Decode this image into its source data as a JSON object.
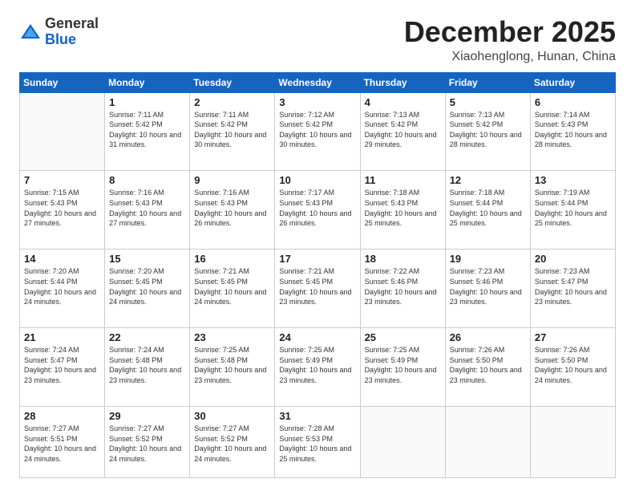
{
  "logo": {
    "general": "General",
    "blue": "Blue"
  },
  "header": {
    "month": "December 2025",
    "location": "Xiaohenglong, Hunan, China"
  },
  "weekdays": [
    "Sunday",
    "Monday",
    "Tuesday",
    "Wednesday",
    "Thursday",
    "Friday",
    "Saturday"
  ],
  "weeks": [
    [
      {
        "day": "",
        "sunrise": "",
        "sunset": "",
        "daylight": ""
      },
      {
        "day": "1",
        "sunrise": "Sunrise: 7:11 AM",
        "sunset": "Sunset: 5:42 PM",
        "daylight": "Daylight: 10 hours and 31 minutes."
      },
      {
        "day": "2",
        "sunrise": "Sunrise: 7:11 AM",
        "sunset": "Sunset: 5:42 PM",
        "daylight": "Daylight: 10 hours and 30 minutes."
      },
      {
        "day": "3",
        "sunrise": "Sunrise: 7:12 AM",
        "sunset": "Sunset: 5:42 PM",
        "daylight": "Daylight: 10 hours and 30 minutes."
      },
      {
        "day": "4",
        "sunrise": "Sunrise: 7:13 AM",
        "sunset": "Sunset: 5:42 PM",
        "daylight": "Daylight: 10 hours and 29 minutes."
      },
      {
        "day": "5",
        "sunrise": "Sunrise: 7:13 AM",
        "sunset": "Sunset: 5:42 PM",
        "daylight": "Daylight: 10 hours and 28 minutes."
      },
      {
        "day": "6",
        "sunrise": "Sunrise: 7:14 AM",
        "sunset": "Sunset: 5:43 PM",
        "daylight": "Daylight: 10 hours and 28 minutes."
      }
    ],
    [
      {
        "day": "7",
        "sunrise": "Sunrise: 7:15 AM",
        "sunset": "Sunset: 5:43 PM",
        "daylight": "Daylight: 10 hours and 27 minutes."
      },
      {
        "day": "8",
        "sunrise": "Sunrise: 7:16 AM",
        "sunset": "Sunset: 5:43 PM",
        "daylight": "Daylight: 10 hours and 27 minutes."
      },
      {
        "day": "9",
        "sunrise": "Sunrise: 7:16 AM",
        "sunset": "Sunset: 5:43 PM",
        "daylight": "Daylight: 10 hours and 26 minutes."
      },
      {
        "day": "10",
        "sunrise": "Sunrise: 7:17 AM",
        "sunset": "Sunset: 5:43 PM",
        "daylight": "Daylight: 10 hours and 26 minutes."
      },
      {
        "day": "11",
        "sunrise": "Sunrise: 7:18 AM",
        "sunset": "Sunset: 5:43 PM",
        "daylight": "Daylight: 10 hours and 25 minutes."
      },
      {
        "day": "12",
        "sunrise": "Sunrise: 7:18 AM",
        "sunset": "Sunset: 5:44 PM",
        "daylight": "Daylight: 10 hours and 25 minutes."
      },
      {
        "day": "13",
        "sunrise": "Sunrise: 7:19 AM",
        "sunset": "Sunset: 5:44 PM",
        "daylight": "Daylight: 10 hours and 25 minutes."
      }
    ],
    [
      {
        "day": "14",
        "sunrise": "Sunrise: 7:20 AM",
        "sunset": "Sunset: 5:44 PM",
        "daylight": "Daylight: 10 hours and 24 minutes."
      },
      {
        "day": "15",
        "sunrise": "Sunrise: 7:20 AM",
        "sunset": "Sunset: 5:45 PM",
        "daylight": "Daylight: 10 hours and 24 minutes."
      },
      {
        "day": "16",
        "sunrise": "Sunrise: 7:21 AM",
        "sunset": "Sunset: 5:45 PM",
        "daylight": "Daylight: 10 hours and 24 minutes."
      },
      {
        "day": "17",
        "sunrise": "Sunrise: 7:21 AM",
        "sunset": "Sunset: 5:45 PM",
        "daylight": "Daylight: 10 hours and 23 minutes."
      },
      {
        "day": "18",
        "sunrise": "Sunrise: 7:22 AM",
        "sunset": "Sunset: 5:46 PM",
        "daylight": "Daylight: 10 hours and 23 minutes."
      },
      {
        "day": "19",
        "sunrise": "Sunrise: 7:23 AM",
        "sunset": "Sunset: 5:46 PM",
        "daylight": "Daylight: 10 hours and 23 minutes."
      },
      {
        "day": "20",
        "sunrise": "Sunrise: 7:23 AM",
        "sunset": "Sunset: 5:47 PM",
        "daylight": "Daylight: 10 hours and 23 minutes."
      }
    ],
    [
      {
        "day": "21",
        "sunrise": "Sunrise: 7:24 AM",
        "sunset": "Sunset: 5:47 PM",
        "daylight": "Daylight: 10 hours and 23 minutes."
      },
      {
        "day": "22",
        "sunrise": "Sunrise: 7:24 AM",
        "sunset": "Sunset: 5:48 PM",
        "daylight": "Daylight: 10 hours and 23 minutes."
      },
      {
        "day": "23",
        "sunrise": "Sunrise: 7:25 AM",
        "sunset": "Sunset: 5:48 PM",
        "daylight": "Daylight: 10 hours and 23 minutes."
      },
      {
        "day": "24",
        "sunrise": "Sunrise: 7:25 AM",
        "sunset": "Sunset: 5:49 PM",
        "daylight": "Daylight: 10 hours and 23 minutes."
      },
      {
        "day": "25",
        "sunrise": "Sunrise: 7:25 AM",
        "sunset": "Sunset: 5:49 PM",
        "daylight": "Daylight: 10 hours and 23 minutes."
      },
      {
        "day": "26",
        "sunrise": "Sunrise: 7:26 AM",
        "sunset": "Sunset: 5:50 PM",
        "daylight": "Daylight: 10 hours and 23 minutes."
      },
      {
        "day": "27",
        "sunrise": "Sunrise: 7:26 AM",
        "sunset": "Sunset: 5:50 PM",
        "daylight": "Daylight: 10 hours and 24 minutes."
      }
    ],
    [
      {
        "day": "28",
        "sunrise": "Sunrise: 7:27 AM",
        "sunset": "Sunset: 5:51 PM",
        "daylight": "Daylight: 10 hours and 24 minutes."
      },
      {
        "day": "29",
        "sunrise": "Sunrise: 7:27 AM",
        "sunset": "Sunset: 5:52 PM",
        "daylight": "Daylight: 10 hours and 24 minutes."
      },
      {
        "day": "30",
        "sunrise": "Sunrise: 7:27 AM",
        "sunset": "Sunset: 5:52 PM",
        "daylight": "Daylight: 10 hours and 24 minutes."
      },
      {
        "day": "31",
        "sunrise": "Sunrise: 7:28 AM",
        "sunset": "Sunset: 5:53 PM",
        "daylight": "Daylight: 10 hours and 25 minutes."
      },
      {
        "day": "",
        "sunrise": "",
        "sunset": "",
        "daylight": ""
      },
      {
        "day": "",
        "sunrise": "",
        "sunset": "",
        "daylight": ""
      },
      {
        "day": "",
        "sunrise": "",
        "sunset": "",
        "daylight": ""
      }
    ]
  ]
}
